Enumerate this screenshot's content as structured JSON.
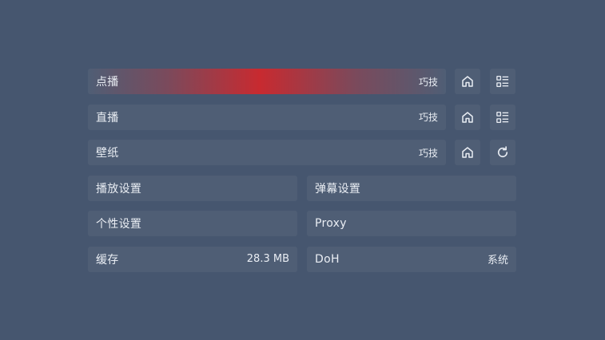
{
  "rows": {
    "vod": {
      "label": "点播",
      "tip": "巧技"
    },
    "live": {
      "label": "直播",
      "tip": "巧技"
    },
    "wallpaper": {
      "label": "壁纸",
      "tip": "巧技"
    }
  },
  "settings": {
    "player": {
      "label": "播放设置"
    },
    "danmaku": {
      "label": "弹幕设置"
    },
    "personal": {
      "label": "个性设置"
    },
    "proxy": {
      "label": "Proxy"
    },
    "cache": {
      "label": "缓存",
      "value": "28.3 MB"
    },
    "doh": {
      "label": "DoH",
      "value": "系统"
    }
  },
  "icons": {
    "home": "home-icon",
    "list": "list-icon",
    "refresh": "refresh-icon"
  },
  "colors": {
    "background": "#46566f",
    "item": "#4f5e75",
    "accent": "#c82a30",
    "text": "#e9edf3"
  }
}
